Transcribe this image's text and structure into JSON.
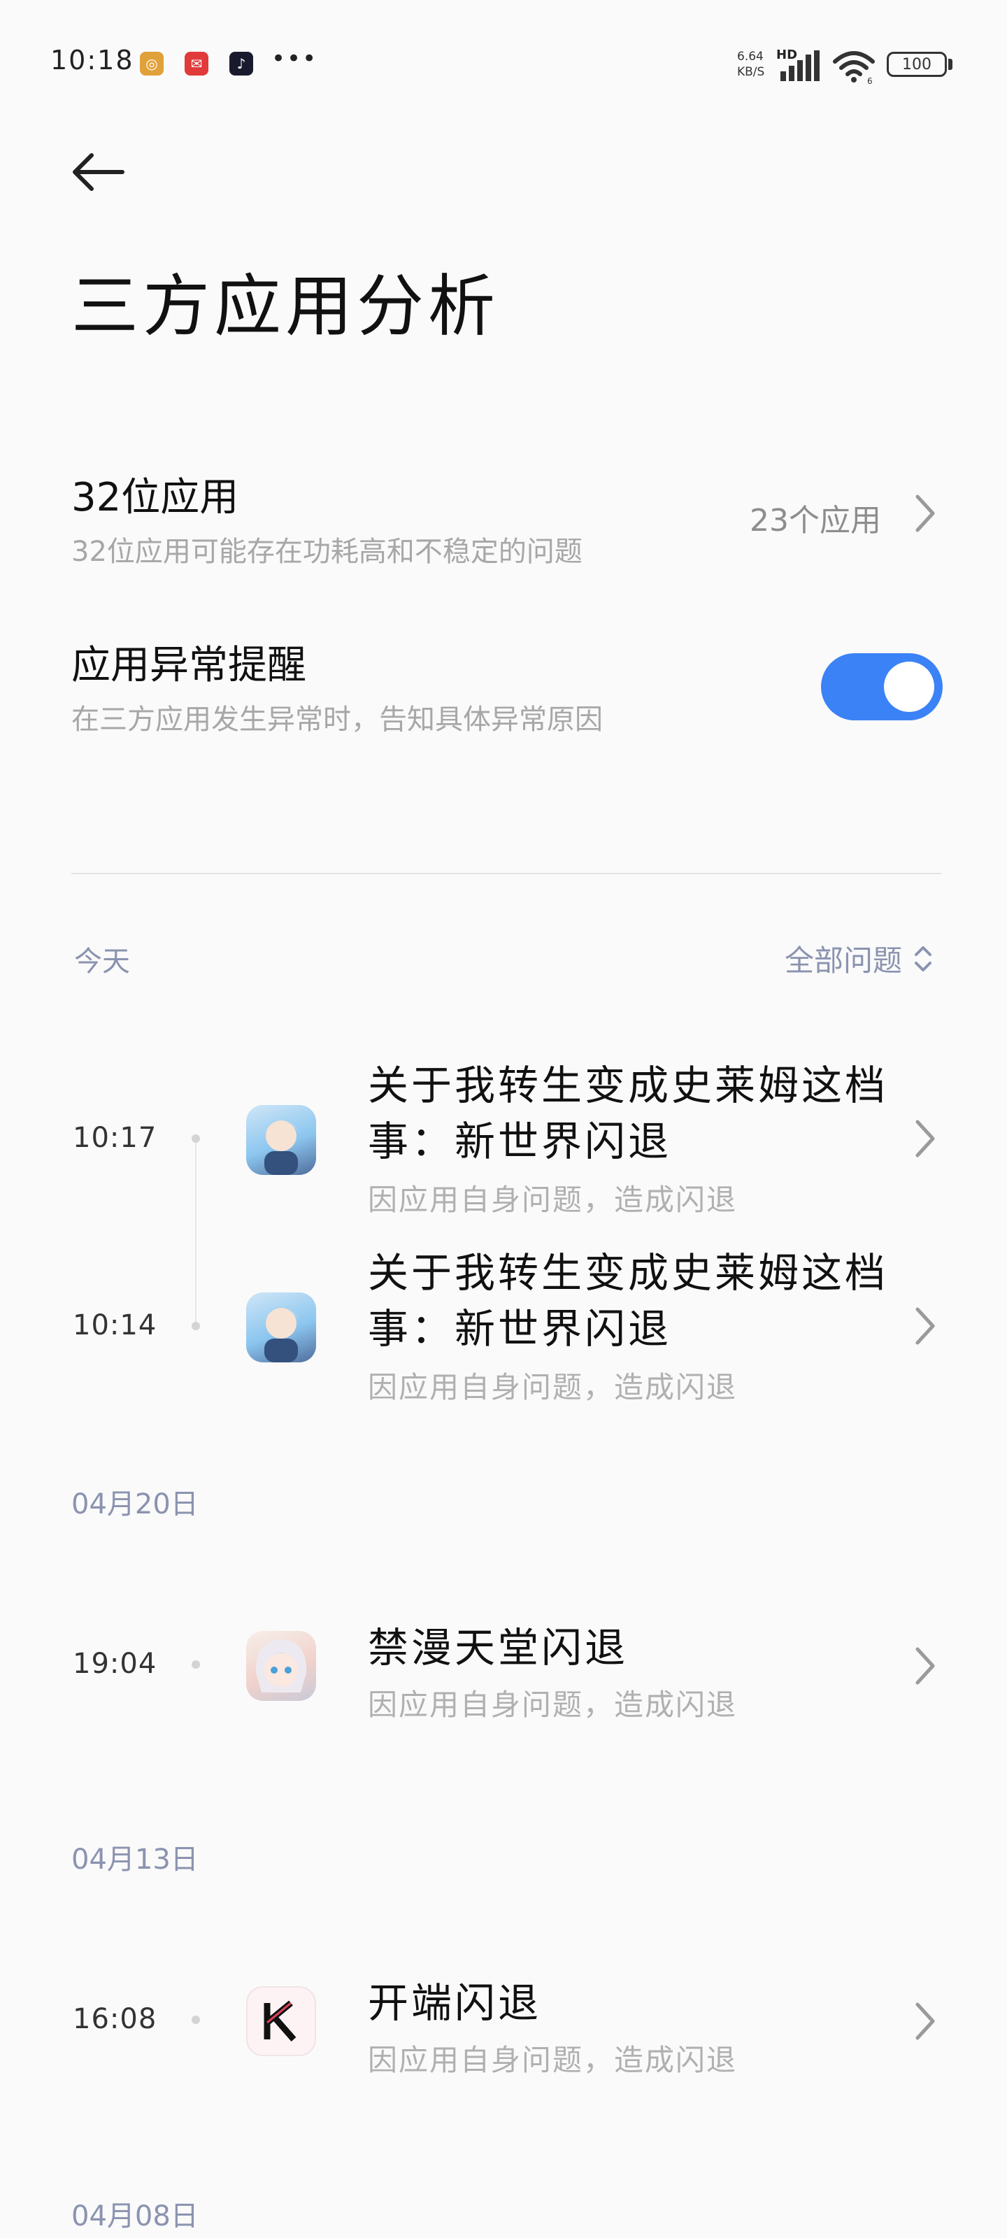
{
  "status_bar": {
    "time": "10:18",
    "net_speed_value": "6.64",
    "net_speed_unit": "KB/S",
    "hd": "HD",
    "wifi_label": "6",
    "battery": "100"
  },
  "header": {
    "title": "三方应用分析"
  },
  "settings": {
    "apps32": {
      "title": "32位应用",
      "subtitle": "32位应用可能存在功耗高和不稳定的问题",
      "value": "23个应用"
    },
    "alert": {
      "title": "应用异常提醒",
      "subtitle": "在三方应用发生异常时，告知具体异常原因",
      "enabled": true
    }
  },
  "filter": {
    "label": "全部问题"
  },
  "sections": [
    {
      "date": "今天",
      "entries": [
        {
          "time": "10:17",
          "title": "关于我转生变成史莱姆这档事：新世界闪退",
          "subtitle": "因应用自身问题，造成闪退"
        },
        {
          "time": "10:14",
          "title": "关于我转生变成史莱姆这档事：新世界闪退",
          "subtitle": "因应用自身问题，造成闪退"
        }
      ]
    },
    {
      "date": "04月20日",
      "entries": [
        {
          "time": "19:04",
          "title": "禁漫天堂闪退",
          "subtitle": "因应用自身问题，造成闪退"
        }
      ]
    },
    {
      "date": "04月13日",
      "entries": [
        {
          "time": "16:08",
          "title": "开端闪退",
          "subtitle": "因应用自身问题，造成闪退"
        }
      ]
    },
    {
      "date": "04月08日",
      "entries": []
    }
  ],
  "colors": {
    "accent": "#3b82f6",
    "section_label": "#8b93b0",
    "subtitle": "#b0b0b0"
  }
}
